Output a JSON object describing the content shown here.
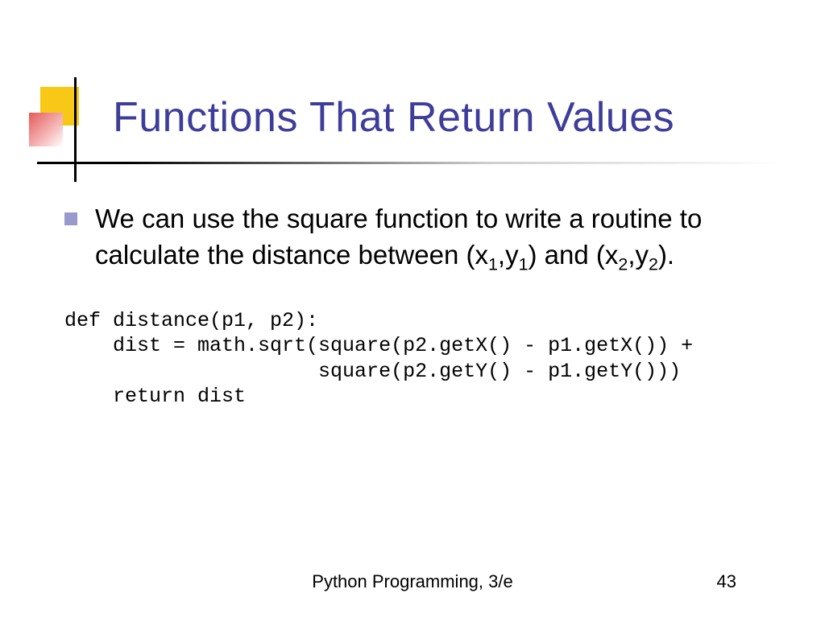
{
  "title": "Functions That Return Values",
  "bullet": {
    "prefix": "We can use the square function to write a routine to calculate the distance between (x",
    "s1": "1",
    "mid1": ",y",
    "s2": "1",
    "mid2": ") and (x",
    "s3": "2",
    "mid3": ",y",
    "s4": "2",
    "suffix": ")."
  },
  "code": "def distance(p1, p2):\n    dist = math.sqrt(square(p2.getX() - p1.getX()) +\n                     square(p2.getY() - p1.getY()))\n    return dist",
  "footer": {
    "book": "Python Programming, 3/e",
    "page": "43"
  }
}
